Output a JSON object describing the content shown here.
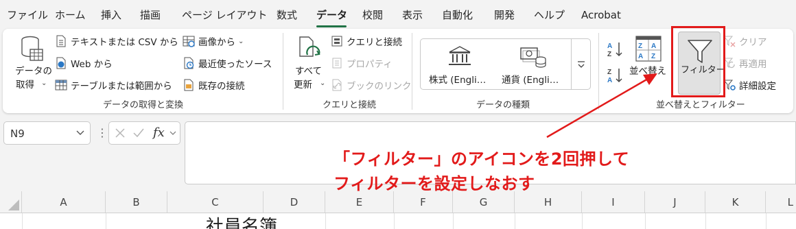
{
  "menu": {
    "tabs": [
      "ファイル",
      "ホーム",
      "挿入",
      "描画",
      "ページ レイアウト",
      "数式",
      "データ",
      "校閲",
      "表示",
      "自動化",
      "開発",
      "ヘルプ",
      "Acrobat"
    ],
    "active": "データ"
  },
  "ribbon": {
    "get_data": {
      "big_button_line1": "データの",
      "big_button_line2": "取得",
      "from_text_csv": "テキストまたは CSV から",
      "from_web": "Web から",
      "from_table": "テーブルまたは範囲から",
      "from_picture": "画像から",
      "recent_sources": "最近使ったソース",
      "existing_connections": "既存の接続",
      "group_label": "データの取得と変換"
    },
    "queries": {
      "refresh_line1": "すべて",
      "refresh_line2": "更新",
      "queries_connections": "クエリと接続",
      "properties": "プロパティ",
      "edit_links": "ブックのリンク",
      "group_label": "クエリと接続"
    },
    "data_types": {
      "stocks": "株式 (Engli…",
      "currencies": "通貨 (Engli…",
      "group_label": "データの種類"
    },
    "sort_filter": {
      "sort": "並べ替え",
      "filter": "フィルター",
      "clear": "クリア",
      "reapply": "再適用",
      "advanced": "詳細設定",
      "group_label": "並べ替えとフィルター"
    }
  },
  "formula_bar": {
    "name_box": "N9",
    "formula": ""
  },
  "grid": {
    "columns": [
      "A",
      "B",
      "C",
      "D",
      "E",
      "F",
      "G",
      "H",
      "I",
      "J",
      "K",
      "L"
    ],
    "cell_text": "社員名簿"
  },
  "annotation": {
    "line1": "「フィルター」のアイコンを2回押して",
    "line2": "フィルターを設定しなおす",
    "color": "#e21a1a"
  },
  "colors": {
    "accent": "#217346",
    "highlight": "#e21a1a",
    "ribbon_bg": "#ffffff",
    "app_bg": "#f3f3f3"
  }
}
